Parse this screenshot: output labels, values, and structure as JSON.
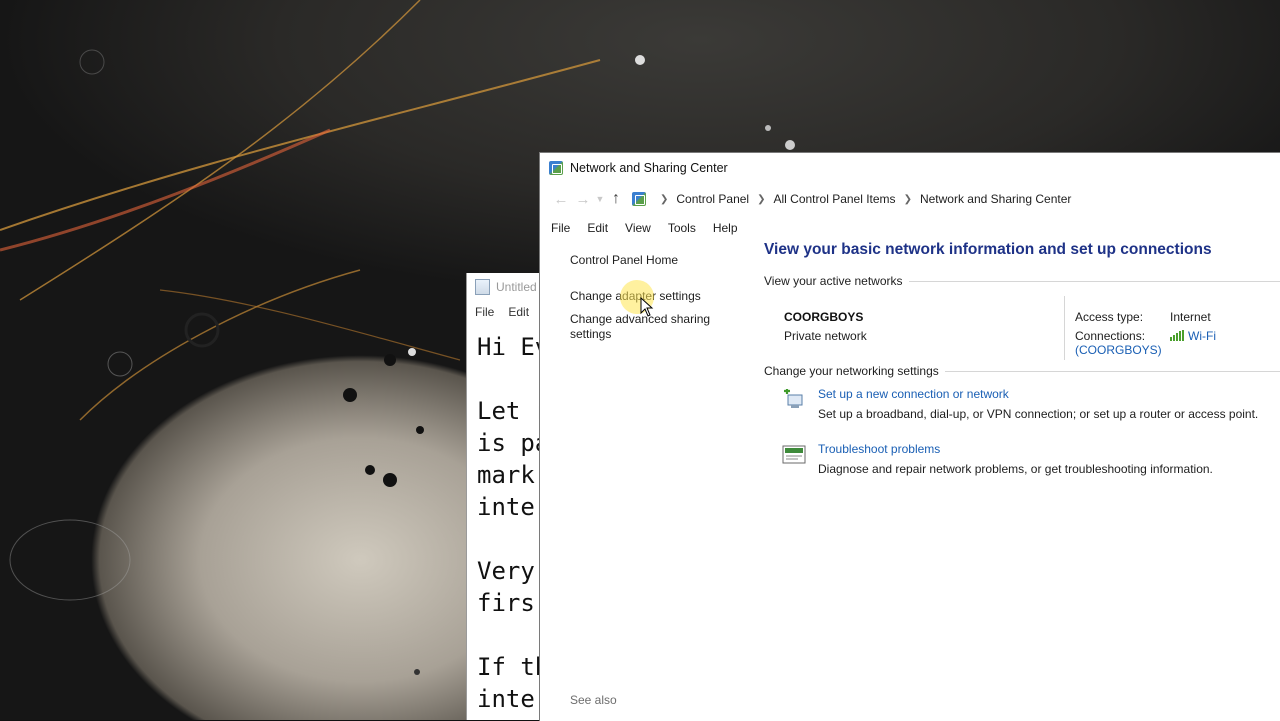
{
  "colors": {
    "link": "#1a5fb4",
    "heading": "#1e3287",
    "signal": "#4aa02c"
  },
  "notepad": {
    "title": "Untitled",
    "menu": [
      "File",
      "Edit"
    ],
    "lines": [
      "Hi Ev",
      "",
      "Let r",
      "is pa",
      "mark",
      "inter",
      "",
      "Very",
      "firs",
      "",
      "If th",
      "inte"
    ]
  },
  "window": {
    "title": "Network and Sharing Center",
    "icon": "control-panel-icon",
    "breadcrumb": [
      "Control Panel",
      "All Control Panel Items",
      "Network and Sharing Center"
    ],
    "menu": [
      "File",
      "Edit",
      "View",
      "Tools",
      "Help"
    ],
    "left_pane": {
      "home": "Control Panel Home",
      "adapter": "Change adapter settings",
      "advanced": "Change advanced sharing settings",
      "see_also": "See also"
    },
    "heading": "View your basic network information and set up connections",
    "active_label": "View your active networks",
    "network": {
      "name": "COORGBOYS",
      "type": "Private network",
      "access_key": "Access type:",
      "access_val": "Internet",
      "conn_key": "Connections:",
      "conn_val": "Wi-Fi (COORGBOYS)"
    },
    "change_label": "Change your networking settings",
    "tasks": [
      {
        "title": "Set up a new connection or network",
        "desc": "Set up a broadband, dial-up, or VPN connection; or set up a router or access point.",
        "icon": "new-connection-icon"
      },
      {
        "title": "Troubleshoot problems",
        "desc": "Diagnose and repair network problems, or get troubleshooting information.",
        "icon": "troubleshoot-icon"
      }
    ]
  }
}
